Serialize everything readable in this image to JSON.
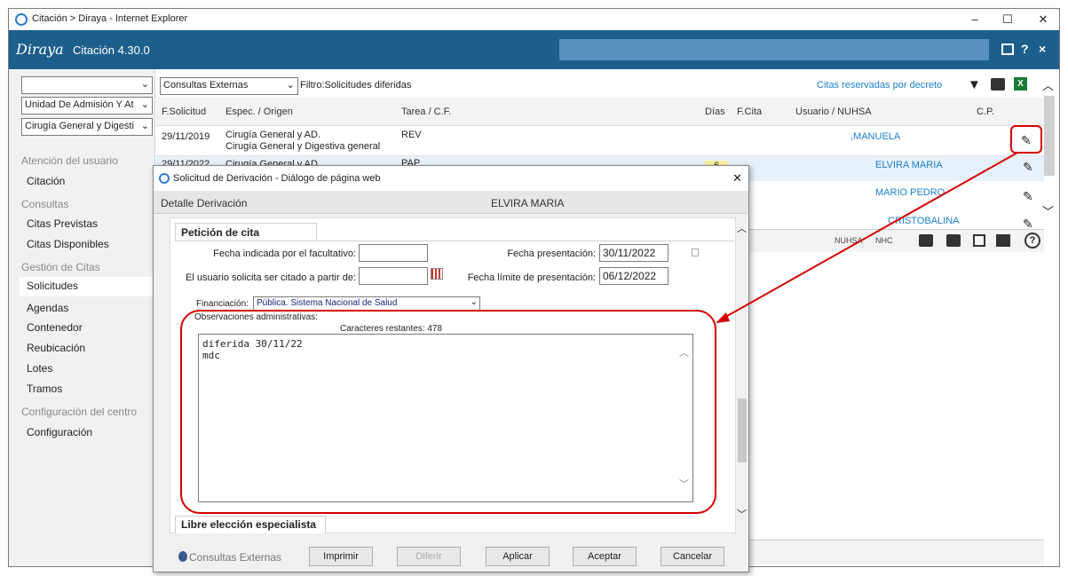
{
  "window": {
    "title": "Citación > Diraya - Internet Explorer",
    "minimize": "–",
    "maximize": "☐",
    "close": "✕"
  },
  "app": {
    "logo": "Diraya",
    "version": "Citación 4.30.0"
  },
  "filters": {
    "select1": "",
    "select2": "Unidad De Admisión Y At",
    "select3": "Cirugía General y Digesti",
    "consultas": "Consultas Externas",
    "filtro": "Filtro:Solicitudes diferidas",
    "citas_decreto": "Citas reservadas por decreto"
  },
  "nav": {
    "sec1": "Atención del usuario",
    "item_citacion": "Citación",
    "sec2": "Consultas",
    "item_previstas": "Citas Previstas",
    "item_disponibles": "Citas Disponibles",
    "sec3": "Gestión de Citas",
    "item_solicitudes": "Solicitudes",
    "item_agendas": "Agendas",
    "item_contenedor": "Contenedor",
    "item_reubicacion": "Reubicación",
    "item_lotes": "Lotes",
    "item_tramos": "Tramos",
    "sec4": "Configuración del centro",
    "item_configuracion": "Configuración"
  },
  "table": {
    "headers": {
      "fsolicitud": "F.Solicitud",
      "espec": "Espec. / Origen",
      "tarea": "Tarea / C.F.",
      "dias": "Días",
      "fcita": "F.Cita",
      "usuario": "Usuario / NUHSA",
      "cp": "C.P."
    },
    "rows": [
      {
        "fecha": "29/11/2019",
        "espec": "Cirugía General y AD.",
        "origen": "Cirugía General y Digestiva general",
        "tarea": "REV",
        "dias": "",
        "usuario": ",MANUELA"
      },
      {
        "fecha": "29/11/2022",
        "espec": "Cirugía General y AD.",
        "origen": "",
        "tarea": "PAP",
        "dias": "6",
        "usuario": "ELVIRA MARIA"
      },
      {
        "usuario": "MARIO PEDRO"
      },
      {
        "usuario": "CRISTOBALINA"
      }
    ],
    "footer_nuhsa": "NUHSA",
    "footer_nhc": "NHC"
  },
  "dialog": {
    "title": "Solicitud de Derivación - Diálogo de página web",
    "detalle": "Detalle Derivación",
    "paciente": "ELVIRA MARIA",
    "peticion_tab": "Petición de cita",
    "lbl_fecha_facultativo": "Fecha indicada por el facultativo:",
    "val_fecha_facultativo": "",
    "lbl_fecha_presentacion": "Fecha presentación:",
    "val_fecha_presentacion": "30/11/2022",
    "lbl_citado_partir": "El usuario solicita ser citado a partir de:",
    "val_citado_partir": "",
    "lbl_fecha_limite": "Fecha límite de presentación:",
    "val_fecha_limite": "06/12/2022",
    "lbl_financiacion": "Financiación:",
    "val_financiacion": "Pública. Sistema Nacional de Salud",
    "lbl_observaciones": "Observaciones administrativas:",
    "caracteres": "Caracteres restantes: 478",
    "obs_line1": "diferida 30/11/22",
    "obs_line2": "mdc",
    "libre_tab": "Libre elección especialista",
    "footer_label": "Consultas Externas",
    "btn_imprimir": "Imprimir",
    "btn_diferir": "Diferir",
    "btn_aplicar": "Aplicar",
    "btn_aceptar": "Aceptar",
    "btn_cancelar": "Cancelar",
    "close": "✕"
  },
  "colors": {
    "app_bar": "#1d5f8c",
    "link": "#1d7fd0",
    "annotation": "#d40000"
  }
}
